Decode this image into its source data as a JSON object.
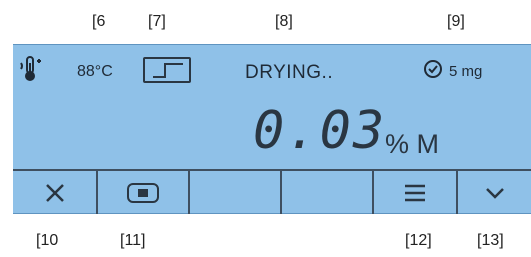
{
  "callouts": {
    "c6": "[6",
    "c7": "[7]",
    "c8": "[8]",
    "c9": "[9]",
    "c10": "[10",
    "c11": "[11]",
    "c12": "[12]",
    "c13": "[13]"
  },
  "status": {
    "temperature": "88°C",
    "state": "DRYING..",
    "sample_weight": "5 mg",
    "icons": {
      "heating": "thermometer-heat-icon",
      "program": "step-program-icon",
      "timer": "clock-check-icon"
    }
  },
  "reading": {
    "value": "0.03",
    "unit": "% M"
  },
  "softkeys": {
    "icons": [
      "close-icon",
      "stop-icon",
      "",
      "",
      "menu-icon",
      "chevron-down-icon"
    ]
  },
  "colors": {
    "display_background": "#8fc1e8",
    "display_foreground": "#2a3642"
  }
}
